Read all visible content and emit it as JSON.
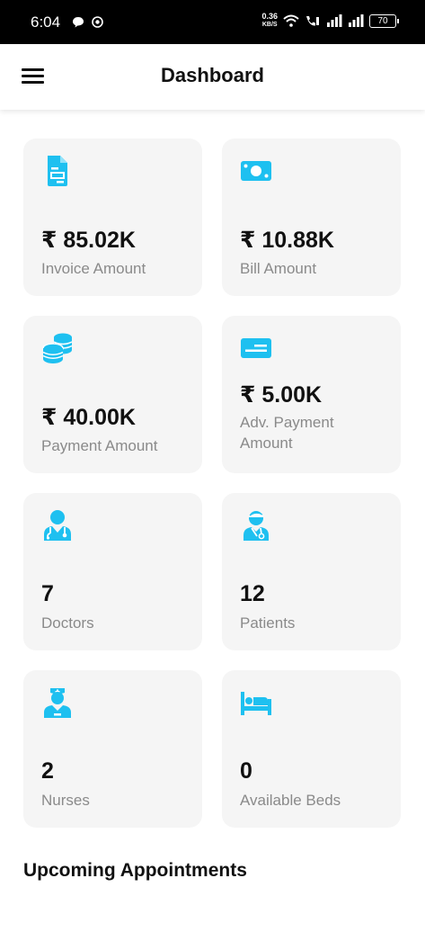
{
  "status_bar": {
    "time": "6:04",
    "speed_value": "0.36",
    "speed_unit": "KB/S",
    "battery": "70"
  },
  "app_bar": {
    "title": "Dashboard",
    "menu_icon": "hamburger-menu-icon"
  },
  "cards": [
    {
      "icon": "invoice-document-icon",
      "value": "₹ 85.02K",
      "label": "Invoice Amount"
    },
    {
      "icon": "money-bill-icon",
      "value": "₹ 10.88K",
      "label": "Bill Amount"
    },
    {
      "icon": "coins-stack-icon",
      "value": "₹ 40.00K",
      "label": "Payment Amount"
    },
    {
      "icon": "payment-card-icon",
      "value": "₹ 5.00K",
      "label": "Adv. Payment Amount"
    },
    {
      "icon": "doctor-icon",
      "value": "7",
      "label": "Doctors"
    },
    {
      "icon": "patient-icon",
      "value": "12",
      "label": "Patients"
    },
    {
      "icon": "nurse-icon",
      "value": "2",
      "label": "Nurses"
    },
    {
      "icon": "bed-icon",
      "value": "0",
      "label": "Available Beds"
    }
  ],
  "upcoming_appointments_title": "Upcoming Appointments",
  "colors": {
    "accent": "#1ec0f0",
    "card_bg": "#f5f5f5",
    "label_gray": "#8a8a8a"
  }
}
